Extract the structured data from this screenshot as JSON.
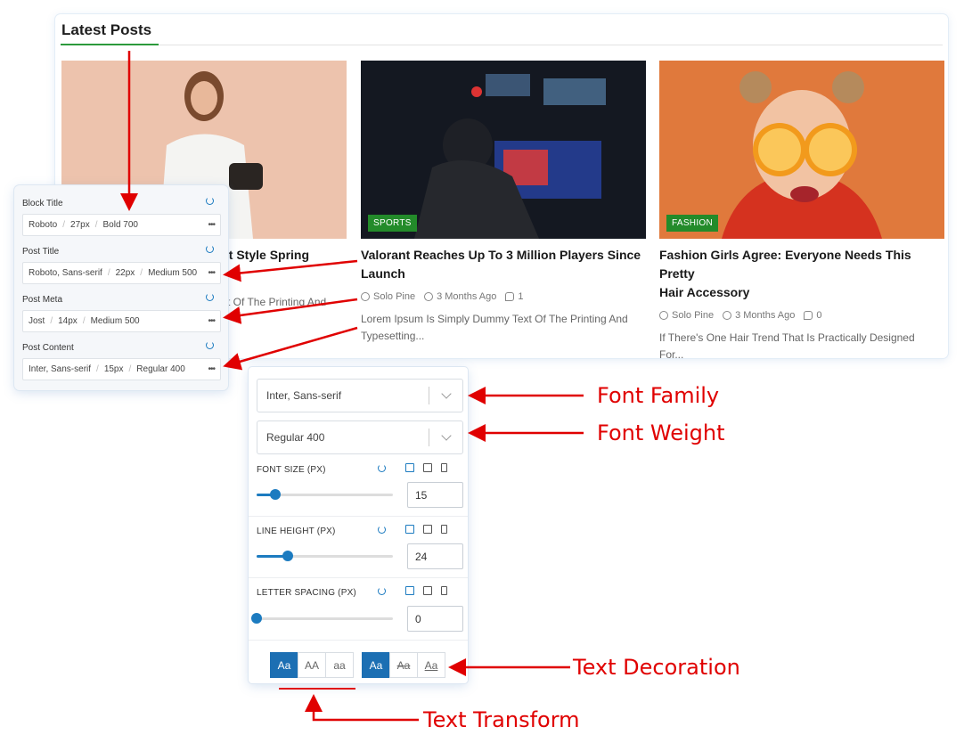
{
  "block_title": "Latest Posts",
  "posts": [
    {
      "category": "",
      "title_line1": "et Style Spring",
      "title_line2": "",
      "author": "",
      "time": "",
      "comments": "",
      "excerpt_line1": "xt Of The Printing And",
      "excerpt_line2": ""
    },
    {
      "category": "SPORTS",
      "title_line1": "Valorant Reaches Up To 3 Million Players Since",
      "title_line2": "Launch",
      "author": "Solo Pine",
      "time": "3 Months Ago",
      "comments": "1",
      "excerpt_line1": "Lorem Ipsum Is Simply Dummy Text Of The Printing And",
      "excerpt_line2": "Typesetting..."
    },
    {
      "category": "FASHION",
      "title_line1": "Fashion Girls Agree: Everyone Needs This Pretty",
      "title_line2": "Hair Accessory",
      "author": "Solo Pine",
      "time": "3 Months Ago",
      "comments": "0",
      "excerpt_line1": "If There's One Hair Trend That Is Practically Designed",
      "excerpt_line2": "For..."
    }
  ],
  "typography": [
    {
      "label": "Block Title",
      "font": "Roboto",
      "size": "27px",
      "weight": "Bold 700"
    },
    {
      "label": "Post Title",
      "font": "Roboto, Sans-serif",
      "size": "22px",
      "weight": "Medium 500"
    },
    {
      "label": "Post Meta",
      "font": "Jost",
      "size": "14px",
      "weight": "Medium 500"
    },
    {
      "label": "Post Content",
      "font": "Inter, Sans-serif",
      "size": "15px",
      "weight": "Regular 400"
    }
  ],
  "settings": {
    "font_family": "Inter, Sans-serif",
    "font_weight": "Regular 400",
    "font_size": {
      "label": "FONT SIZE (PX)",
      "value": "15",
      "level": 0.14
    },
    "line_height": {
      "label": "LINE HEIGHT (PX)",
      "value": "24",
      "level": 0.23
    },
    "letter_spacing": {
      "label": "LETTER SPACING (PX)",
      "value": "0",
      "level": 0.0
    },
    "transform_buttons": [
      "Aa",
      "AA",
      "aa"
    ],
    "decoration_buttons": [
      "Aa",
      "Aa",
      "Aa"
    ]
  },
  "annotations": {
    "font_family": "Font Family",
    "font_weight": "Font Weight",
    "text_decoration": "Text Decoration",
    "text_transform": "Text Transform"
  },
  "colors": {
    "accent": "#1c6fb3",
    "badge": "#238b2a",
    "annotation": "#e00000"
  }
}
